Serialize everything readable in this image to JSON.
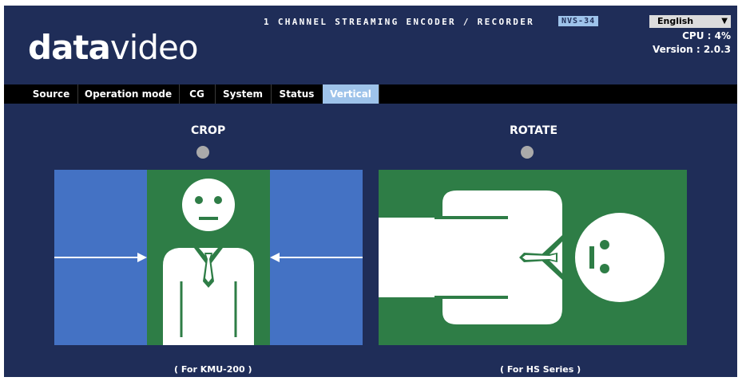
{
  "header": {
    "logo_bold": "data",
    "logo_light": "video",
    "product_title": "1 CHANNEL STREAMING ENCODER / RECORDER",
    "model_badge": "NVS-34",
    "language_selected": "English",
    "cpu_text": "CPU  : 4%",
    "version_text": "Version : 2.0.3"
  },
  "tabs": [
    {
      "label": "Source"
    },
    {
      "label": "Operation mode"
    },
    {
      "label": "CG"
    },
    {
      "label": "System"
    },
    {
      "label": "Status"
    },
    {
      "label": "Vertical"
    }
  ],
  "active_tab": "Vertical",
  "options": {
    "crop": {
      "title": "CROP",
      "caption": "( For KMU-200 )"
    },
    "rotate": {
      "title": "ROTATE",
      "caption": "( For HS Series )"
    }
  },
  "colors": {
    "background": "#1f2d58",
    "tab_active": "#9ec3ea",
    "panel_blue": "#4472c4",
    "panel_green": "#2e7d46",
    "radio": "#aaaaaa"
  }
}
